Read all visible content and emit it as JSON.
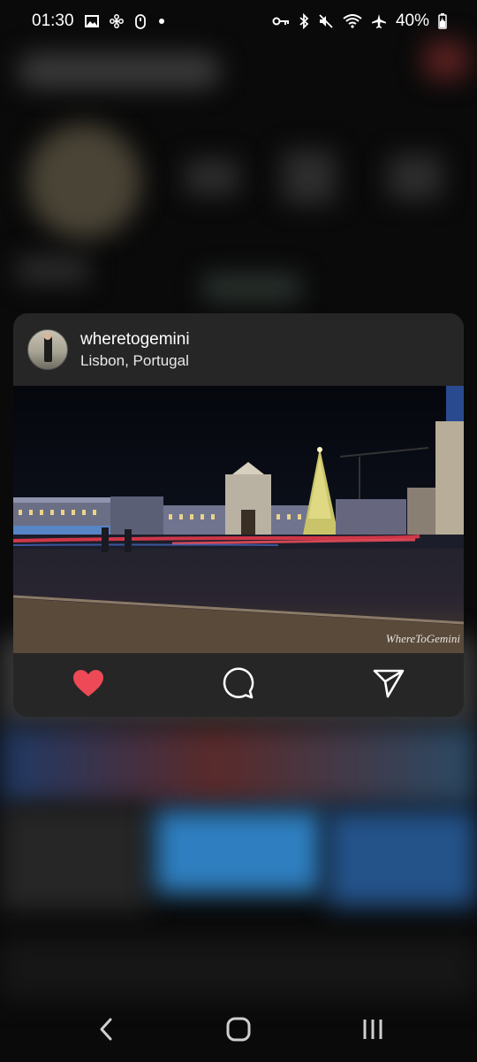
{
  "status_bar": {
    "time": "01:30",
    "battery": "40%",
    "icons_left": [
      "image-icon",
      "fan-icon",
      "mouse-icon",
      "dot-icon"
    ],
    "icons_right": [
      "key-icon",
      "bluetooth-icon",
      "mute-icon",
      "wifi-icon",
      "airplane-icon",
      "battery-icon"
    ]
  },
  "post": {
    "username": "wheretogemini",
    "location": "Lisbon, Portugal",
    "watermark": "WhereToGemini",
    "liked": true,
    "colors": {
      "like": "#ed4956",
      "card": "#262626"
    }
  },
  "actions": [
    "heart-icon",
    "comment-icon",
    "send-icon"
  ],
  "nav": [
    "back-icon",
    "home-icon",
    "recents-icon"
  ]
}
